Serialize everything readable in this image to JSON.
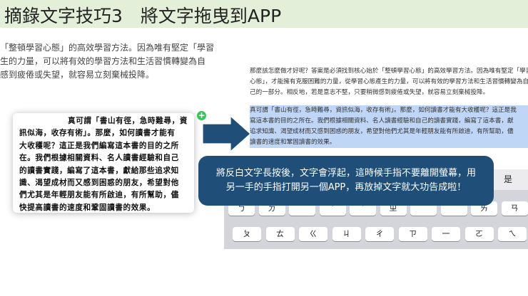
{
  "header": {
    "title": "摘錄文字技巧3　將文字拖曳到APP"
  },
  "left_doc": {
    "lines": [
      "「整頓學習心態」的高效學習方法。因為唯有堅定「學習",
      "生的力量，可以將有效的學習方法和生活習慣轉變為自",
      "感到疲倦或失望，就容易立刻棄械投降。"
    ]
  },
  "drag_card": {
    "lines": [
      "真可謂「書山有徑，急時難尋，資",
      "訊似海，收存有術」。那麼，如何讀書才能有",
      "大收穫呢？這正是我們編寫這本書的目的之所",
      "在。我們根據相關資料、名人讀書經驗和自己",
      "的讀書實踐，編寫了這本書，獻給那些追求知",
      "識、渴望成材而又感到困惑的朋友，希望對他",
      "們尤其是年輕朋友能有所啟迪，有所幫助，儘",
      "快提高讀書的速度和鞏固讀書的效果。"
    ]
  },
  "right_doc": {
    "paragraph1": [
      "那麼該怎麼做才好呢？答案是必須找到核心始於「整頓學習心態」的高效學習方法。因為唯有堅定「學習",
      "心態」，才能擁有克服困難的力量，從學習心態產生的力量，可以將有效的學習方法和生活習慣轉變為自",
      "己的一部分。相反地，若是意志不堅，只要稍微感到疲倦或失望，就容易立刻棄械投降。"
    ],
    "paragraph2": [
      "真可謂「書山有徑，急時難尋，資訊似海，收存有術」。那麼，如何讀書才能有大收穫呢？這正是我",
      "寫這本書的目的之所在。我們根據相關資料、名人讀書經驗和自己的讀書實踐，編寫了這本書，獻",
      "追求知識、渴望成材而又感到困惑的朋友，希望對他們尤其是年輕朋友能有所啟迪，有所幫助，儘",
      "讀書的速度和鞏固讀書的效果。"
    ]
  },
  "keyboard": {
    "suggestion": "是",
    "row1": [
      "ㄅ",
      "ㄉ",
      "",
      "ˇ",
      "ˋ",
      "ㄓ",
      "",
      "",
      "ㄞ",
      "ㄢ"
    ],
    "row2": [
      "ㄆ",
      "ㄊ",
      "",
      "",
      "",
      "ㄔ",
      "",
      "",
      "",
      "ㄞ"
    ],
    "row3": [
      "ㄆ",
      "ㄊ",
      "ㄍ",
      "ㄐ",
      "ㄔ",
      "ㄗ",
      "一",
      "ㄛ",
      "ㄟ"
    ]
  },
  "callout": {
    "lines": [
      "將反白文字長按後，文字會浮起，這時候手指不要離開螢幕，用",
      "另一手的手指打開另一個APP，再放掉文字就大功告成啦！"
    ]
  },
  "colors": {
    "header_bg": "#e3efd9",
    "callout_bg": "#1f4f79",
    "arrow_fill": "#1f4f79",
    "add_badge": "#34c759",
    "selection": "#bfd6f6"
  },
  "icons": {
    "add_badge": "plus-icon",
    "arrow": "right-arrow-icon"
  }
}
